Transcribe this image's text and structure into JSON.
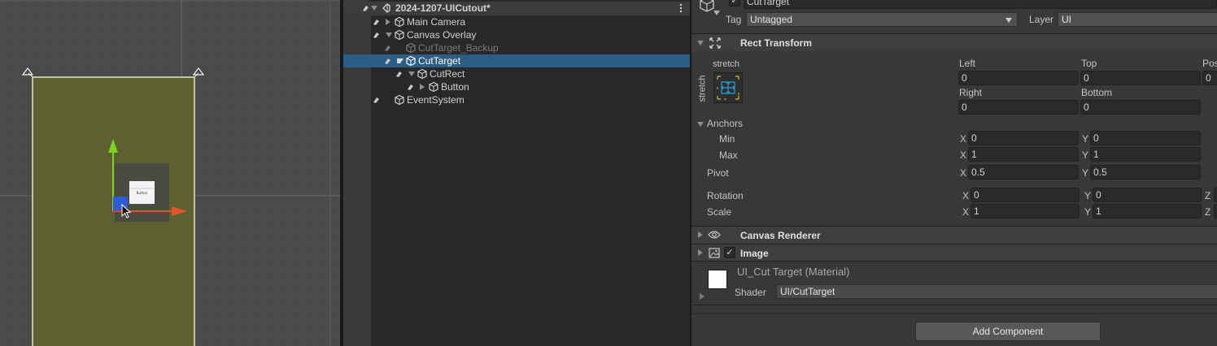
{
  "scene_view": {
    "button_caption": "Button"
  },
  "hierarchy": {
    "scene_name": "2024-1207-UICutout*",
    "items": [
      {
        "label": "Main Camera",
        "depth": 0,
        "expandable": true,
        "expanded": false,
        "active": true,
        "selected": false
      },
      {
        "label": "Canvas Overlay",
        "depth": 0,
        "expandable": true,
        "expanded": true,
        "active": true,
        "selected": false
      },
      {
        "label": "CutTarget_Backup",
        "depth": 1,
        "expandable": false,
        "expanded": false,
        "active": false,
        "selected": false
      },
      {
        "label": "CutTarget",
        "depth": 1,
        "expandable": true,
        "expanded": true,
        "active": true,
        "selected": true
      },
      {
        "label": "CutRect",
        "depth": 2,
        "expandable": true,
        "expanded": true,
        "active": true,
        "selected": false
      },
      {
        "label": "Button",
        "depth": 3,
        "expandable": true,
        "expanded": false,
        "active": true,
        "selected": false
      },
      {
        "label": "EventSystem",
        "depth": 0,
        "expandable": false,
        "expanded": false,
        "active": true,
        "selected": false
      }
    ]
  },
  "inspector": {
    "object_name": "CutTarget",
    "object_active": true,
    "tag_label": "Tag",
    "tag_value": "Untagged",
    "layer_label": "Layer",
    "layer_value": "UI",
    "rect_transform": {
      "title": "Rect Transform",
      "anchor_preset_top": "stretch",
      "anchor_preset_side": "stretch",
      "left_label": "Left",
      "left_value": "0",
      "top_label": "Top",
      "top_value": "0",
      "pos_label": "Pos",
      "pos_value": "0",
      "right_label": "Right",
      "right_value": "0",
      "bottom_label": "Bottom",
      "bottom_value": "0",
      "anchors_label": "Anchors",
      "min_label": "Min",
      "min_x": "0",
      "min_y": "0",
      "max_label": "Max",
      "max_x": "1",
      "max_y": "1",
      "pivot_label": "Pivot",
      "pivot_x": "0.5",
      "pivot_y": "0.5",
      "rotation_label": "Rotation",
      "rotation_x": "0",
      "rotation_y": "0",
      "scale_label": "Scale",
      "scale_x": "1",
      "scale_y": "1",
      "axis_x": "X",
      "axis_y": "Y",
      "axis_z": "Z"
    },
    "canvas_renderer": {
      "title": "Canvas Renderer"
    },
    "image": {
      "title": "Image",
      "enabled": true
    },
    "material": {
      "name": "UI_Cut Target (Material)",
      "shader_label": "Shader",
      "shader_value": "UI/CutTarget"
    },
    "add_component_label": "Add Component"
  },
  "colors": {
    "scene_background": "#4a4a4a",
    "canvas_fill": "#5d6132",
    "canvas_outline": "#e6e6c8",
    "selection": "#2c5d87",
    "gizmo_y": "#7ed321",
    "gizmo_x": "#e0552c",
    "gizmo_xy": "#2f5bd6",
    "anchor_cross": "#2aa0d6",
    "anchor_frame": "#d6b84a"
  }
}
